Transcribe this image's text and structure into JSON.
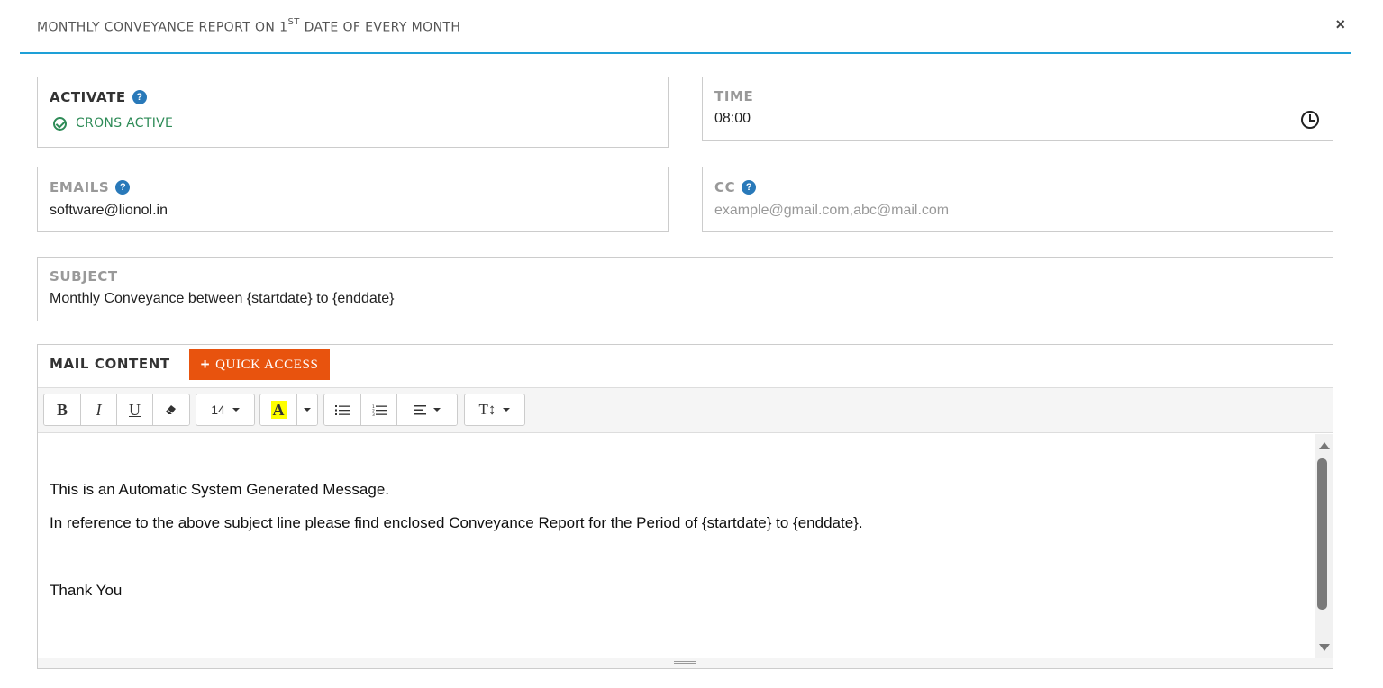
{
  "header": {
    "title_pre": "MONTHLY CONVEYANCE REPORT ON 1",
    "title_sup": "ST",
    "title_post": " DATE OF EVERY MONTH",
    "close": "×"
  },
  "activate": {
    "label": "ACTIVATE",
    "status": "CRONS ACTIVE",
    "status_color": "#2e8b57"
  },
  "time": {
    "label": "TIME",
    "value": "08:00",
    "icon": "clock-icon"
  },
  "emails": {
    "label": "EMAILS",
    "value": "software@lionol.in"
  },
  "cc": {
    "label": "CC",
    "placeholder": "example@gmail.com,abc@mail.com"
  },
  "subject": {
    "label": "SUBJECT",
    "value": "Monthly Conveyance between {startdate} to {enddate}"
  },
  "mail_content": {
    "label": "MAIL CONTENT",
    "quick_access": "QUICK ACCESS",
    "quick_access_color": "#e8530e",
    "toolbar": {
      "bold": "B",
      "italic": "I",
      "underline": "U",
      "font_size": "14",
      "highlight": "A",
      "highlight_color": "#ffff00",
      "text_style": "T↕"
    },
    "lines": [
      "This is an Automatic System Generated Message.",
      "In reference to the above subject line please find enclosed Conveyance Report for the Period of {startdate} to {enddate}.",
      "Thank You"
    ]
  },
  "help_icon": "?",
  "accent_color": "#1ea0d7"
}
